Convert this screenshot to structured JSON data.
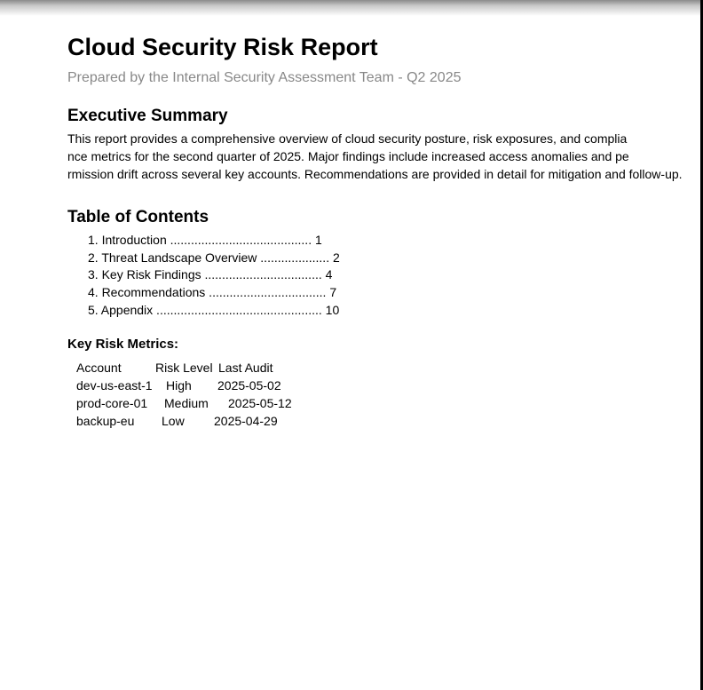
{
  "report": {
    "title": "Cloud Security Risk Report",
    "subtitle": "Prepared by the Internal Security Assessment Team - Q2 2025"
  },
  "executive_summary": {
    "heading": "Executive Summary",
    "lines": [
      "This report provides a comprehensive overview of cloud security posture, risk exposures, and complia",
      "nce metrics for the second quarter of 2025. Major findings include increased access anomalies and pe",
      "rmission drift across several key accounts. Recommendations are provided in detail for mitigation and follow-up."
    ]
  },
  "toc": {
    "heading": "Table of Contents",
    "items": [
      "1. Introduction ......................................... 1",
      "2. Threat Landscape Overview .................... 2",
      "3. Key Risk Findings .................................. 4",
      "4. Recommendations .................................. 7",
      "5. Appendix ................................................ 10"
    ]
  },
  "metrics": {
    "heading": "Key Risk Metrics:",
    "header": [
      "Account",
      "Risk Level",
      "Last Audit"
    ],
    "rows": [
      [
        "dev-us-east-1",
        "High",
        "2025-05-02"
      ],
      [
        "prod-core-01",
        "Medium",
        "2025-05-12"
      ],
      [
        "backup-eu",
        "Low",
        "2025-04-29"
      ]
    ]
  }
}
